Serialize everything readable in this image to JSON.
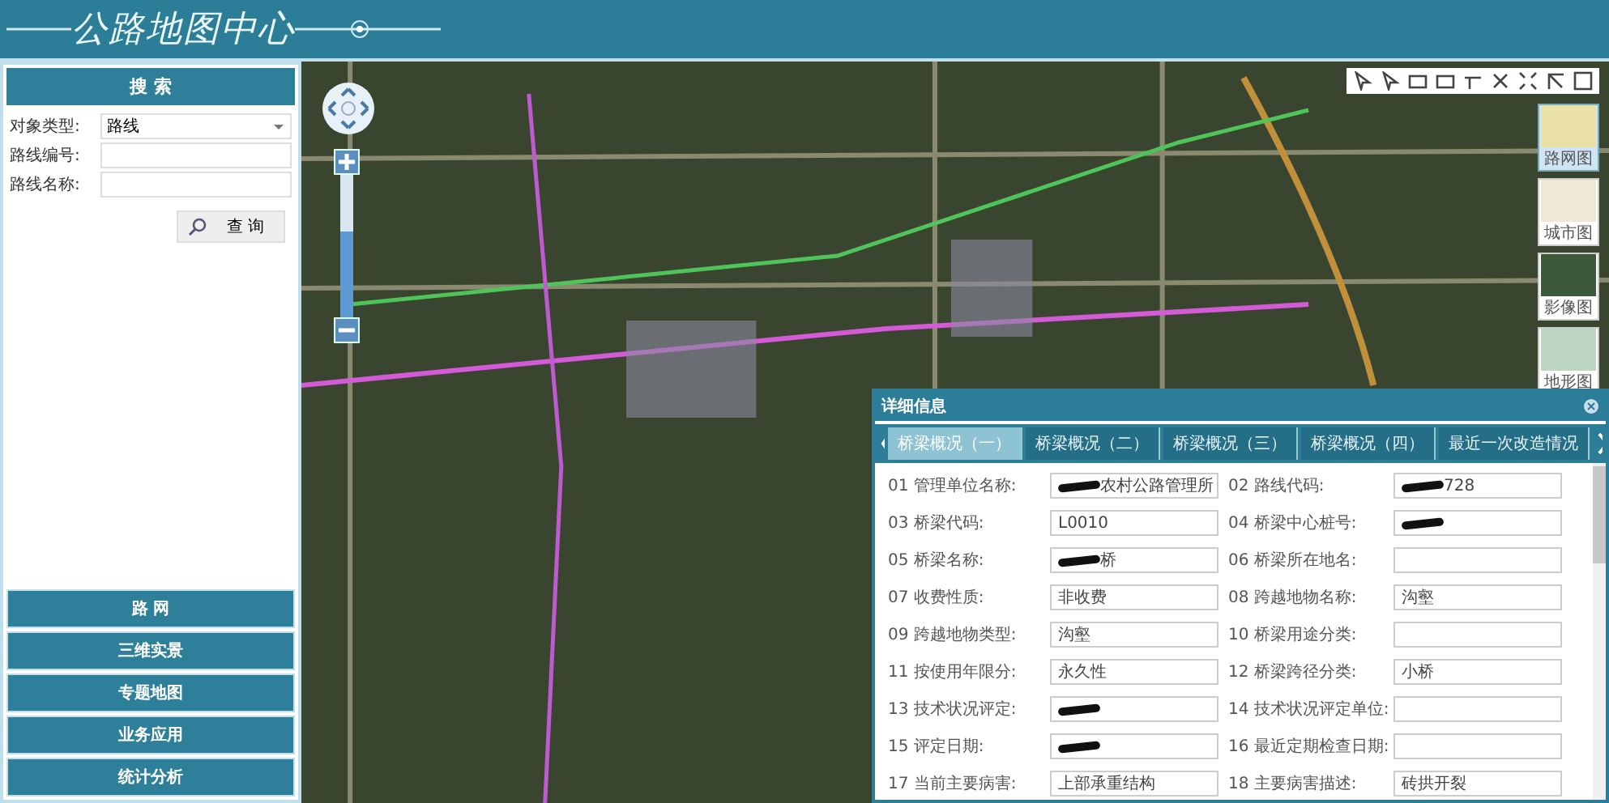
{
  "header": {
    "title": "公路地图中心"
  },
  "search": {
    "title": "搜 索",
    "fields": [
      {
        "kind": "select",
        "label": "对象类型:",
        "value": "路线"
      },
      {
        "kind": "text",
        "label": "路线编号:"
      },
      {
        "kind": "text",
        "label": "路线名称:"
      }
    ],
    "button": "查 询"
  },
  "nav": [
    {
      "label": "路 网",
      "selected": false
    },
    {
      "label": "三维实景",
      "selected": false
    },
    {
      "label": "专题地图",
      "selected": false
    },
    {
      "label": "业务应用",
      "selected": false
    },
    {
      "label": "统计分析",
      "selected": false
    }
  ],
  "map": {
    "zoom": {
      "level": 0.6
    },
    "basemaps": [
      {
        "label": "路网图",
        "selected": true
      },
      {
        "label": "城市图",
        "selected": false
      },
      {
        "label": "影像图",
        "selected": false
      },
      {
        "label": "地形图",
        "selected": false
      }
    ]
  },
  "details": {
    "title": "详细信息",
    "tabs": [
      {
        "label": "桥梁概况（一）",
        "selected": true
      },
      {
        "label": "桥梁概况（二）",
        "selected": false
      },
      {
        "label": "桥梁概况（三）",
        "selected": false
      },
      {
        "label": "桥梁概况（四）",
        "selected": false
      },
      {
        "label": "最近一次改造情况",
        "selected": false
      }
    ],
    "fields": [
      {
        "label": "01 管理单位名称:",
        "value": "农村公路管理所",
        "redacted": true
      },
      {
        "label": "02 路线代码:",
        "value": "728",
        "redacted": true
      },
      {
        "label": "03 桥梁代码:",
        "value": "L0010"
      },
      {
        "label": "04 桥梁中心桩号:",
        "redacted": true
      },
      {
        "label": "05 桥梁名称:",
        "value": "桥",
        "redacted": true
      },
      {
        "label": "06 桥梁所在地名:"
      },
      {
        "label": "07 收费性质:",
        "value": "非收费"
      },
      {
        "label": "08 跨越地物名称:",
        "value": "沟壑"
      },
      {
        "label": "09 跨越地物类型:",
        "value": "沟壑"
      },
      {
        "label": "10 桥梁用途分类:"
      },
      {
        "label": "11 按使用年限分:",
        "value": "永久性"
      },
      {
        "label": "12 桥梁跨径分类:",
        "value": "小桥"
      },
      {
        "label": "13 技术状况评定:",
        "redacted": true
      },
      {
        "label": "14 技术状况评定单位:"
      },
      {
        "label": "15 评定日期:",
        "redacted": true
      },
      {
        "label": "16 最近定期检查日期:"
      },
      {
        "label": "17 当前主要病害:",
        "value": "上部承重结构"
      },
      {
        "label": "18 主要病害描述:",
        "value": "砖拱开裂"
      }
    ]
  }
}
